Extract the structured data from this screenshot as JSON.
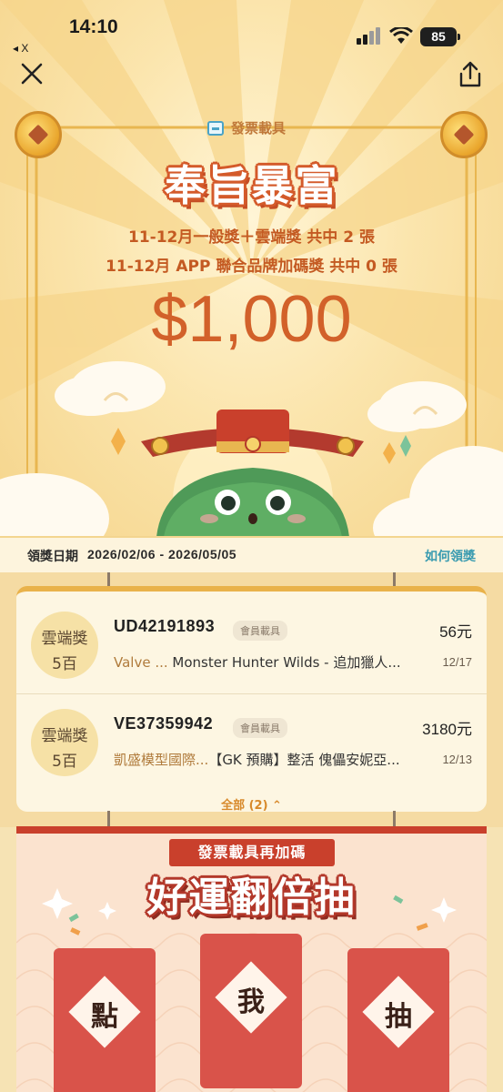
{
  "status_bar": {
    "time": "14:10",
    "back_app": "◂ X",
    "battery": "85"
  },
  "toolbar": {
    "close_icon": "close-icon",
    "share_icon": "share-icon"
  },
  "hero": {
    "carrier_label": "發票載具",
    "title": "奉旨暴富",
    "line1": "11-12月一般獎＋雲端獎 共中 2 張",
    "line2": "11-12月 APP 聯合品牌加碼獎 共中 0 張",
    "amount": "$1,000"
  },
  "claim": {
    "label": "領獎日期",
    "range": "2026/02/06 - 2026/05/05",
    "how_to": "如何領獎"
  },
  "winnings": [
    {
      "prize_type": "雲端獎",
      "prize_value": "5百",
      "invoice_no": "UD42191893",
      "tag": "會員載具",
      "amount": "56元",
      "merchant": "Valve ...",
      "item": " Monster Hunter Wilds - 追加獵人...",
      "date": "12/17"
    },
    {
      "prize_type": "雲端獎",
      "prize_value": "5百",
      "invoice_no": "VE37359942",
      "tag": "會員載具",
      "amount": "3180元",
      "merchant": "凱盛模型國際...",
      "item": "【GK 預購】整活 傀儡安妮亞...",
      "date": "12/13"
    }
  ],
  "show_all": "全部 (2) ⌃",
  "bonus": {
    "ribbon": "發票載具再加碼",
    "title": "好運翻倍抽",
    "envelopes": [
      "點",
      "我",
      "抽"
    ]
  },
  "colors": {
    "accent": "#d2612a",
    "link": "#3a9bb0",
    "red": "#c9402c",
    "gold": "#e9b24a"
  }
}
